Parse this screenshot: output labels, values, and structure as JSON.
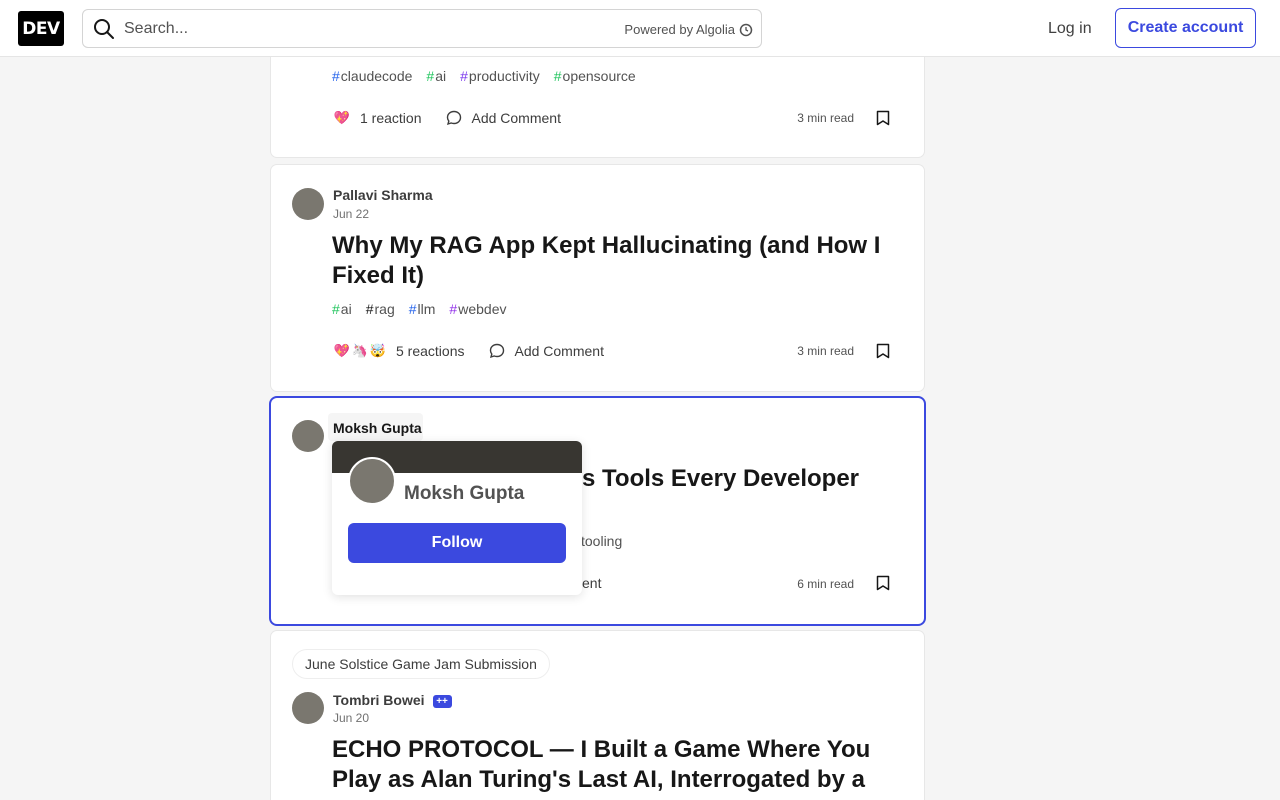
{
  "header": {
    "logo": "DEV",
    "search_placeholder": "Search...",
    "powered_by": "Powered by Algolia",
    "login": "Log in",
    "create_account": "Create account"
  },
  "cards": [
    {
      "tags": [
        {
          "hash": "#",
          "name": "claudecode",
          "color": "#2563eb"
        },
        {
          "hash": "#",
          "name": "ai",
          "color": "#22c55e"
        },
        {
          "hash": "#",
          "name": "productivity",
          "color": "#7c3aed"
        },
        {
          "hash": "#",
          "name": "opensource",
          "color": "#22c55e"
        }
      ],
      "reactions_label": "1 reaction",
      "comment_label": "Add Comment",
      "read_time": "3 min read"
    },
    {
      "author": "Pallavi Sharma",
      "date": "Jun 22",
      "title": "Why My RAG App Kept Hallucinating (and How I Fixed It)",
      "tags": [
        {
          "hash": "#",
          "name": "ai",
          "color": "#22c55e"
        },
        {
          "hash": "#",
          "name": "rag",
          "color": "#171717"
        },
        {
          "hash": "#",
          "name": "llm",
          "color": "#2563eb"
        },
        {
          "hash": "#",
          "name": "webdev",
          "color": "#9333ea"
        }
      ],
      "reactions_label": "5 reactions",
      "comment_label": "Add Comment",
      "read_time": "3 min read"
    },
    {
      "author": "Moksh Gupta",
      "title_visible": "sis Tools Every Developer",
      "tag_visible": "tooling",
      "comment_visible": "ent",
      "read_time": "6 min read"
    },
    {
      "pill": "June Solstice Game Jam Submission",
      "author": "Tombri Bowei",
      "author_badge": "++",
      "date": "Jun 20",
      "title": "ECHO PROTOCOL — I Built a Game Where You Play as Alan Turing's Last AI, Interrogated by a"
    }
  ],
  "popup": {
    "name": "Moksh Gupta",
    "follow": "Follow"
  },
  "colors": {
    "accent": "#3b49df",
    "banner": "#383631"
  }
}
